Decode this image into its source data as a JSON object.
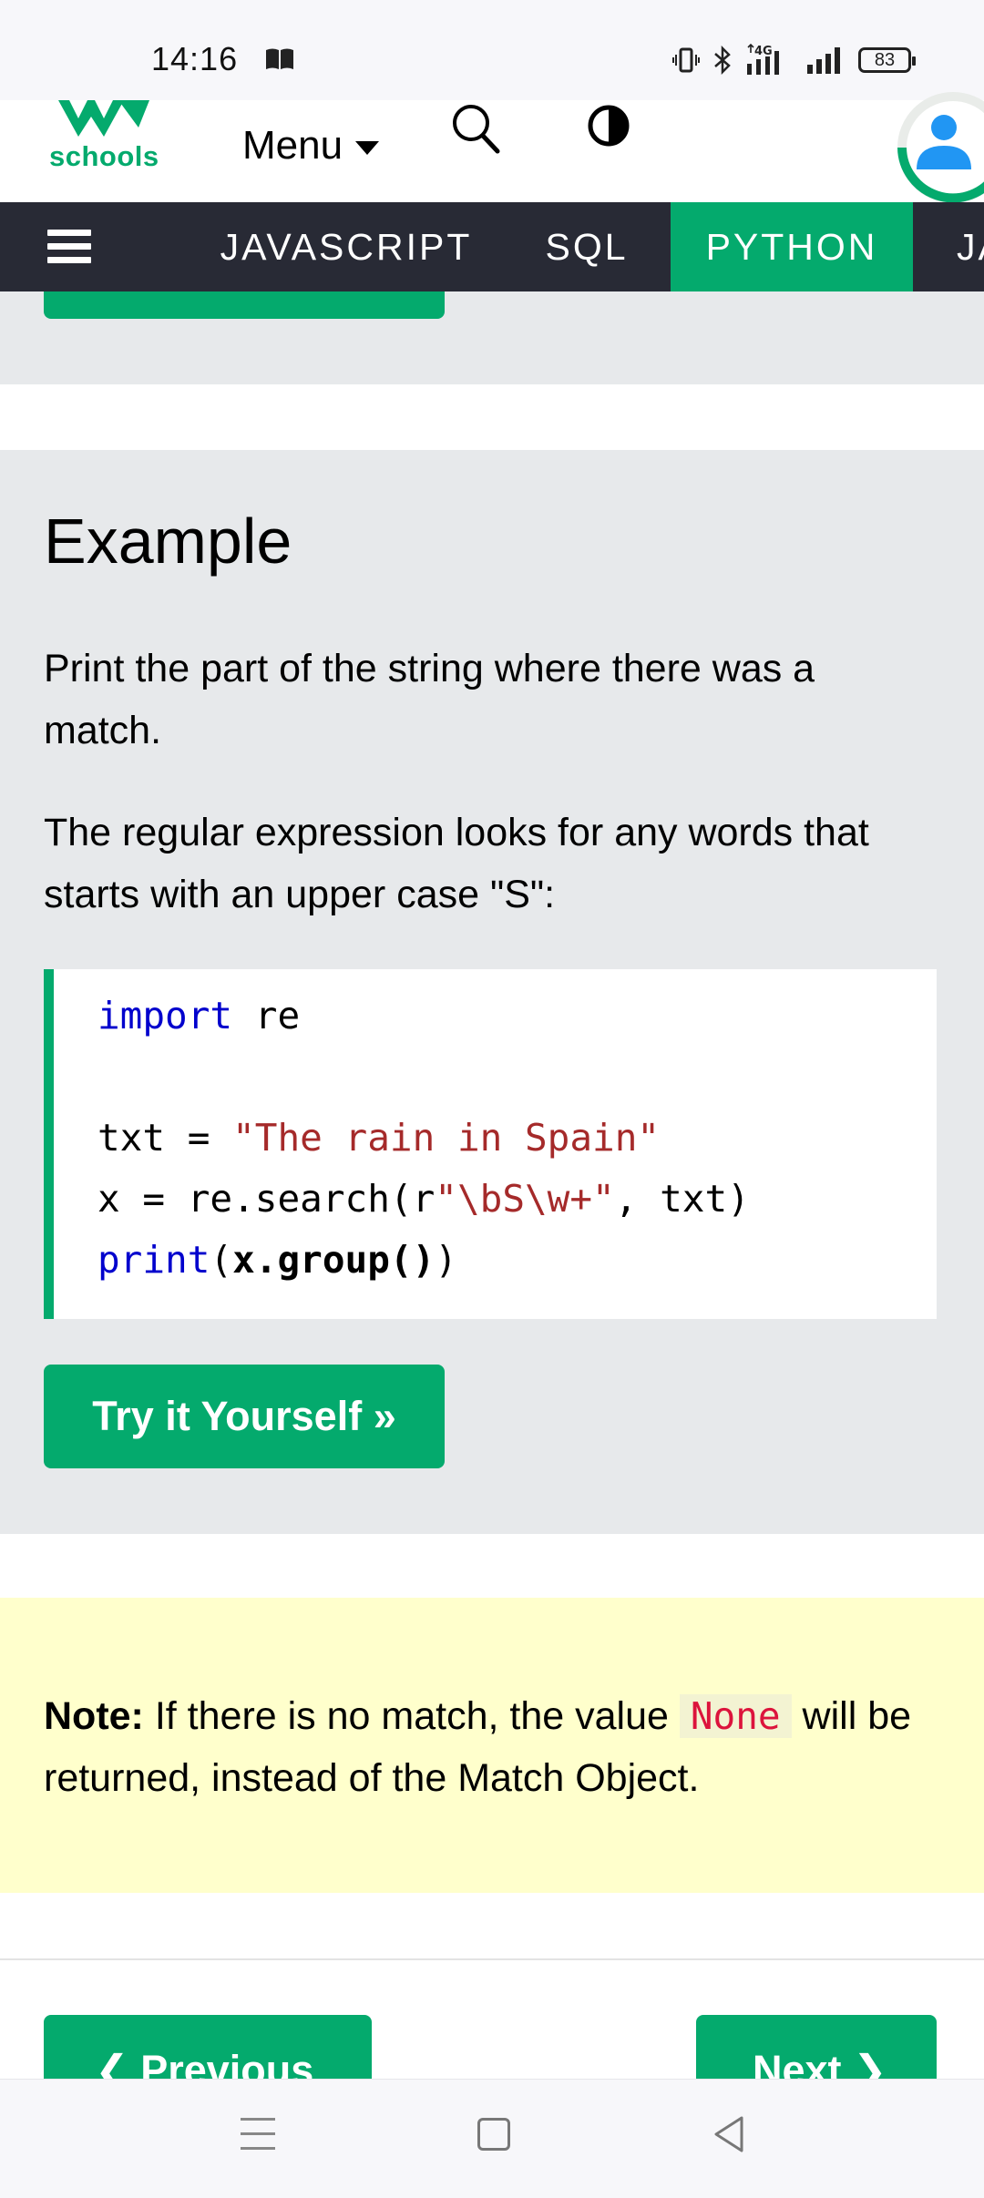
{
  "status_bar": {
    "time": "14:16",
    "network": "4G",
    "battery": "83",
    "icons": [
      "book-icon",
      "vibrate-icon",
      "bluetooth-icon",
      "signal-4g-icon",
      "signal-icon",
      "battery-icon"
    ]
  },
  "header": {
    "logo_text": "schools",
    "menu_label": "Menu",
    "icons": [
      "search-icon",
      "contrast-icon",
      "user-avatar-icon"
    ]
  },
  "topnav": {
    "items": [
      "JAVASCRIPT",
      "SQL",
      "PYTHON",
      "JA"
    ],
    "active": "PYTHON"
  },
  "example": {
    "title": "Example",
    "paragraph1": "Print the part of the string where there was a match.",
    "paragraph2": "The regular expression looks for any words that starts with an upper case \"S\":",
    "code": {
      "line1_kw": "import",
      "line1_rest": " re",
      "line3_a": "txt = ",
      "line3_str": "\"The rain in Spain\"",
      "line4_a": "x = re.search(r",
      "line4_str": "\"\\bS\\w+\"",
      "line4_b": ", txt)",
      "line5_kw": "print",
      "line5_a": "(",
      "line5_bold": "x.group()",
      "line5_b": ")"
    },
    "try_button": "Try it Yourself »"
  },
  "note": {
    "label": "Note:",
    "text_before": " If there is no match, the value ",
    "code": "None",
    "text_after": " will be returned, instead of the Match Object."
  },
  "pagination": {
    "previous": "❮ Previous",
    "next": "Next ❯"
  },
  "colors": {
    "accent": "#04AA6D",
    "nav_bg": "#282A35",
    "panel_bg": "#E7E9EB",
    "note_bg": "#FFFFCC",
    "keyword": "#0000CD",
    "string": "#A52A2A"
  }
}
